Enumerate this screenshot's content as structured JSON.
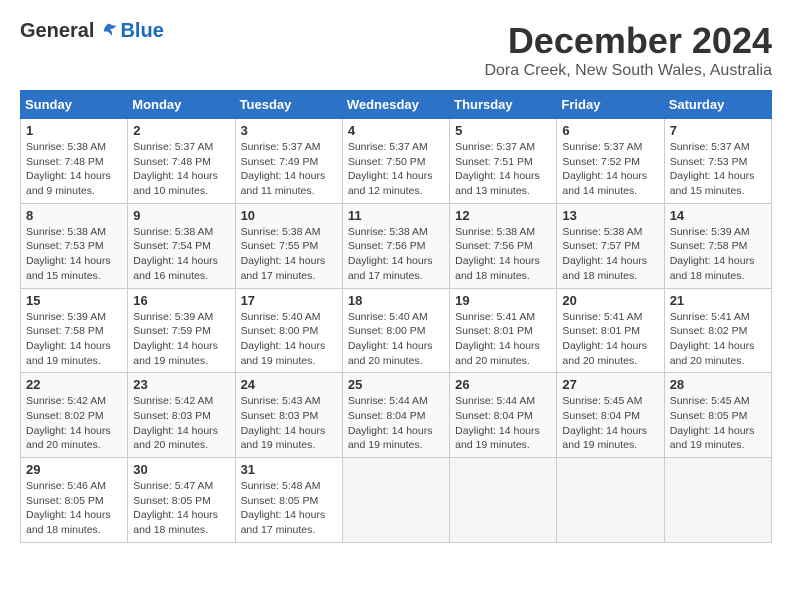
{
  "logo": {
    "general": "General",
    "blue": "Blue"
  },
  "title": "December 2024",
  "location": "Dora Creek, New South Wales, Australia",
  "days_of_week": [
    "Sunday",
    "Monday",
    "Tuesday",
    "Wednesday",
    "Thursday",
    "Friday",
    "Saturday"
  ],
  "weeks": [
    [
      {
        "day": "1",
        "sunrise": "5:38 AM",
        "sunset": "7:48 PM",
        "daylight": "14 hours and 9 minutes."
      },
      {
        "day": "2",
        "sunrise": "5:37 AM",
        "sunset": "7:48 PM",
        "daylight": "14 hours and 10 minutes."
      },
      {
        "day": "3",
        "sunrise": "5:37 AM",
        "sunset": "7:49 PM",
        "daylight": "14 hours and 11 minutes."
      },
      {
        "day": "4",
        "sunrise": "5:37 AM",
        "sunset": "7:50 PM",
        "daylight": "14 hours and 12 minutes."
      },
      {
        "day": "5",
        "sunrise": "5:37 AM",
        "sunset": "7:51 PM",
        "daylight": "14 hours and 13 minutes."
      },
      {
        "day": "6",
        "sunrise": "5:37 AM",
        "sunset": "7:52 PM",
        "daylight": "14 hours and 14 minutes."
      },
      {
        "day": "7",
        "sunrise": "5:37 AM",
        "sunset": "7:53 PM",
        "daylight": "14 hours and 15 minutes."
      }
    ],
    [
      {
        "day": "8",
        "sunrise": "5:38 AM",
        "sunset": "7:53 PM",
        "daylight": "14 hours and 15 minutes."
      },
      {
        "day": "9",
        "sunrise": "5:38 AM",
        "sunset": "7:54 PM",
        "daylight": "14 hours and 16 minutes."
      },
      {
        "day": "10",
        "sunrise": "5:38 AM",
        "sunset": "7:55 PM",
        "daylight": "14 hours and 17 minutes."
      },
      {
        "day": "11",
        "sunrise": "5:38 AM",
        "sunset": "7:56 PM",
        "daylight": "14 hours and 17 minutes."
      },
      {
        "day": "12",
        "sunrise": "5:38 AM",
        "sunset": "7:56 PM",
        "daylight": "14 hours and 18 minutes."
      },
      {
        "day": "13",
        "sunrise": "5:38 AM",
        "sunset": "7:57 PM",
        "daylight": "14 hours and 18 minutes."
      },
      {
        "day": "14",
        "sunrise": "5:39 AM",
        "sunset": "7:58 PM",
        "daylight": "14 hours and 18 minutes."
      }
    ],
    [
      {
        "day": "15",
        "sunrise": "5:39 AM",
        "sunset": "7:58 PM",
        "daylight": "14 hours and 19 minutes."
      },
      {
        "day": "16",
        "sunrise": "5:39 AM",
        "sunset": "7:59 PM",
        "daylight": "14 hours and 19 minutes."
      },
      {
        "day": "17",
        "sunrise": "5:40 AM",
        "sunset": "8:00 PM",
        "daylight": "14 hours and 19 minutes."
      },
      {
        "day": "18",
        "sunrise": "5:40 AM",
        "sunset": "8:00 PM",
        "daylight": "14 hours and 20 minutes."
      },
      {
        "day": "19",
        "sunrise": "5:41 AM",
        "sunset": "8:01 PM",
        "daylight": "14 hours and 20 minutes."
      },
      {
        "day": "20",
        "sunrise": "5:41 AM",
        "sunset": "8:01 PM",
        "daylight": "14 hours and 20 minutes."
      },
      {
        "day": "21",
        "sunrise": "5:41 AM",
        "sunset": "8:02 PM",
        "daylight": "14 hours and 20 minutes."
      }
    ],
    [
      {
        "day": "22",
        "sunrise": "5:42 AM",
        "sunset": "8:02 PM",
        "daylight": "14 hours and 20 minutes."
      },
      {
        "day": "23",
        "sunrise": "5:42 AM",
        "sunset": "8:03 PM",
        "daylight": "14 hours and 20 minutes."
      },
      {
        "day": "24",
        "sunrise": "5:43 AM",
        "sunset": "8:03 PM",
        "daylight": "14 hours and 19 minutes."
      },
      {
        "day": "25",
        "sunrise": "5:44 AM",
        "sunset": "8:04 PM",
        "daylight": "14 hours and 19 minutes."
      },
      {
        "day": "26",
        "sunrise": "5:44 AM",
        "sunset": "8:04 PM",
        "daylight": "14 hours and 19 minutes."
      },
      {
        "day": "27",
        "sunrise": "5:45 AM",
        "sunset": "8:04 PM",
        "daylight": "14 hours and 19 minutes."
      },
      {
        "day": "28",
        "sunrise": "5:45 AM",
        "sunset": "8:05 PM",
        "daylight": "14 hours and 19 minutes."
      }
    ],
    [
      {
        "day": "29",
        "sunrise": "5:46 AM",
        "sunset": "8:05 PM",
        "daylight": "14 hours and 18 minutes."
      },
      {
        "day": "30",
        "sunrise": "5:47 AM",
        "sunset": "8:05 PM",
        "daylight": "14 hours and 18 minutes."
      },
      {
        "day": "31",
        "sunrise": "5:48 AM",
        "sunset": "8:05 PM",
        "daylight": "14 hours and 17 minutes."
      },
      null,
      null,
      null,
      null
    ]
  ],
  "labels": {
    "sunrise": "Sunrise:",
    "sunset": "Sunset:",
    "daylight": "Daylight:"
  }
}
